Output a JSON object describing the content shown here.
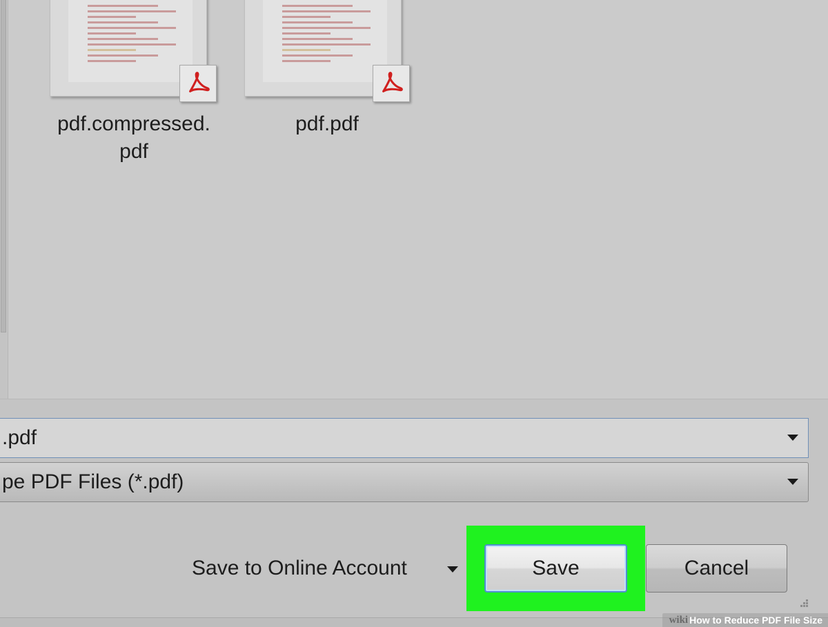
{
  "files": [
    {
      "name_line1": "pdf.compressed.",
      "name_line2": "pdf",
      "icon": "adobe-pdf-icon"
    },
    {
      "name_line1": "pdf.pdf",
      "name_line2": "",
      "icon": "adobe-pdf-icon"
    }
  ],
  "file_name_field": {
    "value": ".pdf"
  },
  "save_as_type": {
    "value": "pe PDF Files (*.pdf)"
  },
  "online_account": {
    "label": "Save to Online Account"
  },
  "buttons": {
    "save": "Save",
    "cancel": "Cancel"
  },
  "watermark": {
    "brand": "wiki",
    "title": "How to Reduce PDF File Size"
  },
  "colors": {
    "highlight": "#1ff21f",
    "pdf_red": "#d0201f",
    "focus_border": "#4f8fcf"
  }
}
